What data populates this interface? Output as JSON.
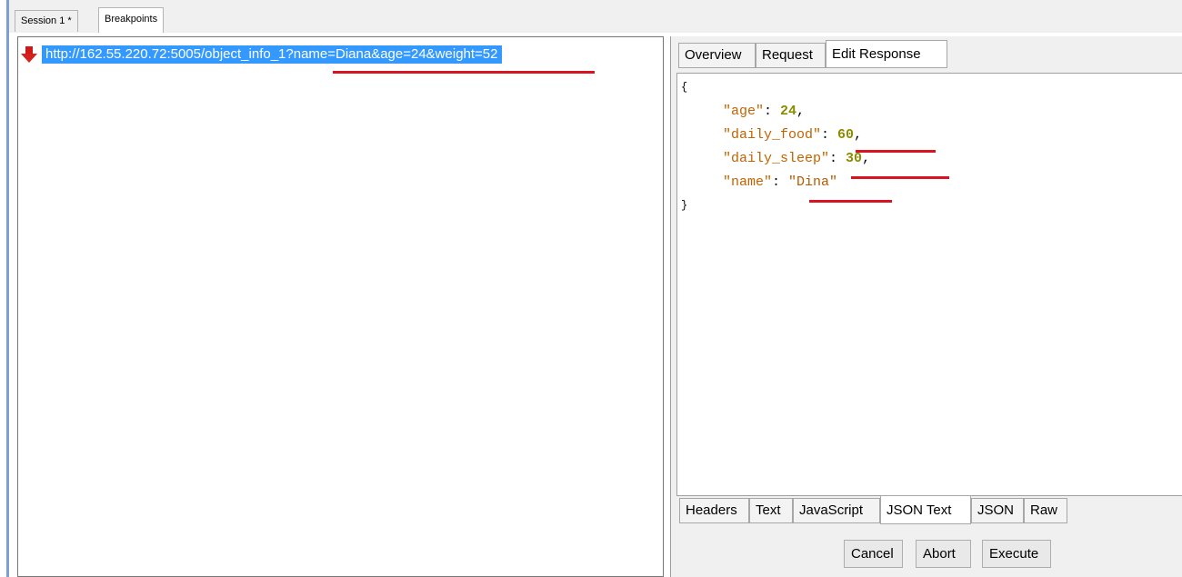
{
  "session_tabs": [
    {
      "label": "Session 1 *"
    },
    {
      "label": "Breakpoints"
    }
  ],
  "breakpoint": {
    "url": "http://162.55.220.72:5005/object_info_1?name=Diana&age=24&weight=52",
    "icon": "red-down-arrow-icon"
  },
  "inspector_tabs": [
    "Overview",
    "Request",
    "Edit Response"
  ],
  "response_json": {
    "open_brace": "{",
    "close_brace": "}",
    "fields": [
      {
        "key": "\"age\"",
        "value": "24",
        "type": "num"
      },
      {
        "key": "\"daily_food\"",
        "value": "60",
        "type": "num"
      },
      {
        "key": "\"daily_sleep\"",
        "value": "30",
        "type": "num"
      },
      {
        "key": "\"name\"",
        "value": "\"Dina\"",
        "type": "str"
      }
    ]
  },
  "view_tabs": [
    "Headers",
    "Text",
    "JavaScript",
    "JSON Text",
    "JSON",
    "Raw"
  ],
  "actions": {
    "cancel": "Cancel",
    "abort": "Abort",
    "execute": "Execute"
  },
  "colors": {
    "highlight": "#3399ff",
    "annotation": "#d9131f",
    "json_key": "#c26300",
    "json_number": "#8b8b00"
  }
}
